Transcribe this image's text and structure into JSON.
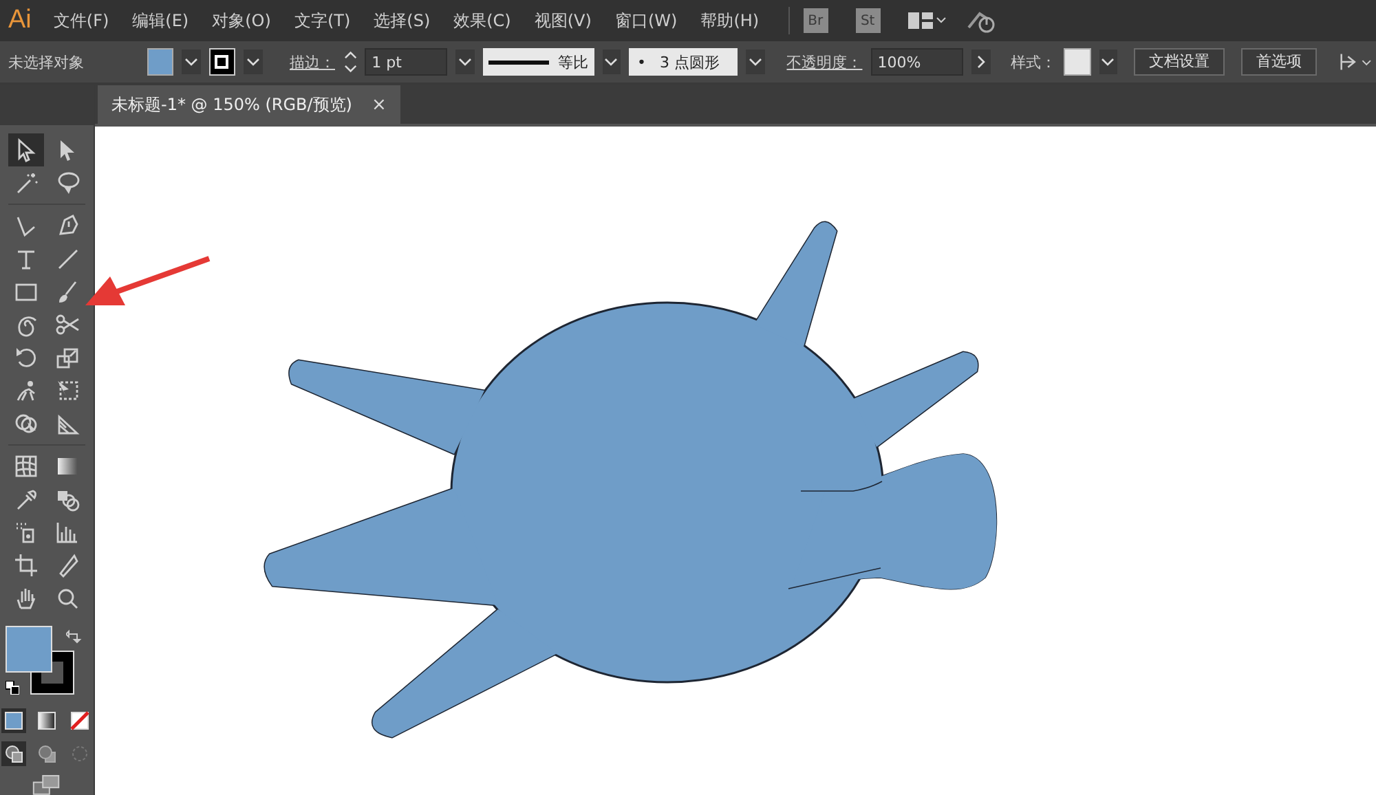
{
  "menu_bar": {
    "logo": "Ai",
    "items": [
      "文件(F)",
      "编辑(E)",
      "对象(O)",
      "文字(T)",
      "选择(S)",
      "效果(C)",
      "视图(V)",
      "窗口(W)",
      "帮助(H)"
    ],
    "app_badges": [
      "Br",
      "St"
    ]
  },
  "control_bar": {
    "selection": "未选择对象",
    "fill": {
      "color": "#6f9dc8"
    },
    "stroke": {
      "color": "#000000"
    },
    "stroke_label": "描边：",
    "stroke_weight": "1 pt",
    "stroke_profile": "等比",
    "brush_dot": "•",
    "brush": "3 点圆形",
    "opacity_label": "不透明度：",
    "opacity": "100%",
    "style_label": "样式：",
    "buttons": [
      "文档设置",
      "首选项"
    ]
  },
  "document_tab": {
    "title": "未标题-1* @ 150% (RGB/预览)",
    "close": "×",
    "selected": true
  },
  "toolbox": {
    "tools": [
      {
        "kind": "selection",
        "selected": true
      },
      {
        "kind": "direct-selection",
        "selected": false
      },
      {
        "kind": "magic-wand",
        "selected": false
      },
      {
        "kind": "lasso",
        "selected": false
      },
      {
        "kind": "curvature",
        "selected": false
      },
      {
        "kind": "pen",
        "selected": false
      },
      {
        "kind": "type",
        "selected": false
      },
      {
        "kind": "line",
        "selected": false
      },
      {
        "kind": "rectangle",
        "selected": false
      },
      {
        "kind": "brush",
        "selected": false
      },
      {
        "kind": "spiral",
        "selected": false
      },
      {
        "kind": "scissors",
        "selected": false
      },
      {
        "kind": "rotate",
        "selected": false
      },
      {
        "kind": "scale",
        "selected": false
      },
      {
        "kind": "figure",
        "selected": false
      },
      {
        "kind": "transform",
        "selected": false
      },
      {
        "kind": "shape-builder",
        "selected": false
      },
      {
        "kind": "perspective",
        "selected": false
      },
      {
        "kind": "mesh",
        "selected": false
      },
      {
        "kind": "gradient",
        "selected": false
      },
      {
        "kind": "eyedropper",
        "selected": false
      },
      {
        "kind": "blend",
        "selected": false
      },
      {
        "kind": "sprayer",
        "selected": false
      },
      {
        "kind": "chart",
        "selected": false
      },
      {
        "kind": "crop",
        "selected": false
      },
      {
        "kind": "knife",
        "selected": false
      },
      {
        "kind": "hand",
        "selected": false
      },
      {
        "kind": "zoom",
        "selected": false
      }
    ],
    "fill": {
      "color": "#6f9dc8"
    },
    "stroke": {
      "color": "#000000"
    },
    "paint_modes": [
      {
        "kind": "color",
        "selected": true
      },
      {
        "kind": "gradient",
        "selected": false
      },
      {
        "kind": "none",
        "selected": false
      }
    ],
    "draw_modes": [
      {
        "kind": "normal",
        "selected": true
      },
      {
        "kind": "behind",
        "selected": false
      },
      {
        "kind": "inside",
        "selected": false
      }
    ]
  }
}
